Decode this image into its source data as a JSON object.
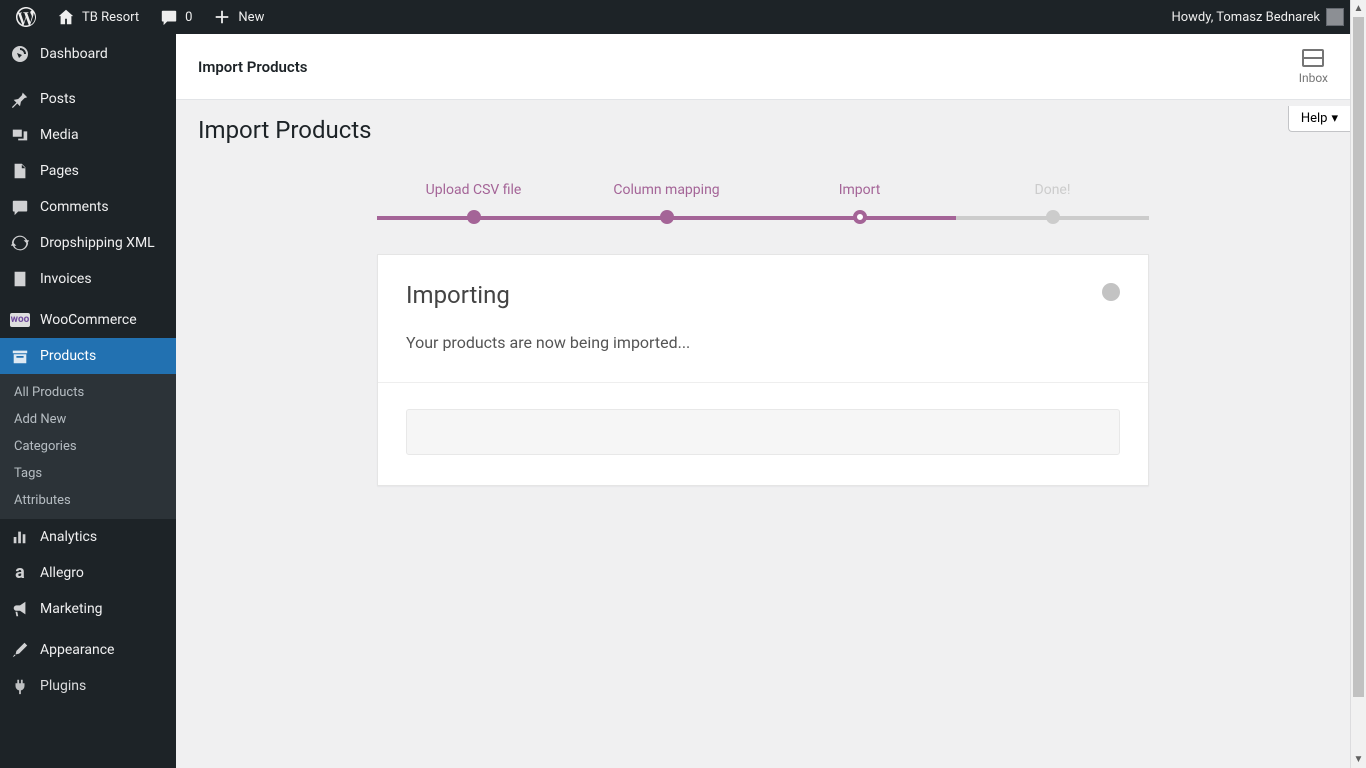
{
  "adminbar": {
    "site_name": "TB Resort",
    "comments_count": "0",
    "new_label": "New",
    "howdy": "Howdy, Tomasz Bednarek"
  },
  "sidebar": {
    "dashboard": "Dashboard",
    "items": [
      {
        "label": "Posts"
      },
      {
        "label": "Media"
      },
      {
        "label": "Pages"
      },
      {
        "label": "Comments"
      },
      {
        "label": "Dropshipping XML"
      },
      {
        "label": "Invoices"
      }
    ],
    "woocommerce": "WooCommerce",
    "products": "Products",
    "products_submenu": [
      {
        "label": "All Products"
      },
      {
        "label": "Add New"
      },
      {
        "label": "Categories"
      },
      {
        "label": "Tags"
      },
      {
        "label": "Attributes"
      }
    ],
    "items2": [
      {
        "label": "Analytics"
      },
      {
        "label": "Allegro"
      },
      {
        "label": "Marketing"
      }
    ],
    "appearance": "Appearance",
    "plugins": "Plugins"
  },
  "topbar": {
    "title": "Import Products",
    "inbox": "Inbox"
  },
  "page": {
    "title": "Import Products",
    "help": "Help"
  },
  "wizard": {
    "steps": [
      {
        "label": "Upload CSV file"
      },
      {
        "label": "Column mapping"
      },
      {
        "label": "Import"
      },
      {
        "label": "Done!"
      }
    ],
    "heading": "Importing",
    "message": "Your products are now being imported..."
  }
}
